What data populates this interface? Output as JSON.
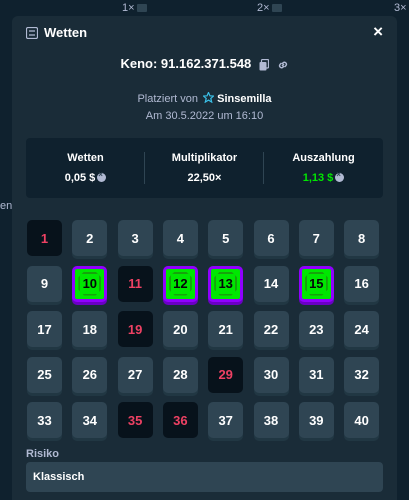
{
  "background": {
    "multipliers": [
      "1×",
      "2×",
      "3×"
    ],
    "side_text": "en"
  },
  "modal": {
    "title": "Wetten",
    "title_icon": "ticket-icon",
    "close_label": "×",
    "game_id": "Keno: 91.162.371.548",
    "placed_by_prefix": "Platziert von",
    "username": "Sinsemilla",
    "date": "Am 30.5.2022 um 16:10"
  },
  "stats": {
    "bet_label": "Wetten",
    "bet_value": "0,05 $",
    "multiplier_label": "Multiplikator",
    "multiplier_value": "22,50×",
    "payout_label": "Auszahlung",
    "payout_value": "1,13 $"
  },
  "keno": {
    "numbers": [
      "1",
      "2",
      "3",
      "4",
      "5",
      "6",
      "7",
      "8",
      "9",
      "10",
      "11",
      "12",
      "13",
      "14",
      "15",
      "16",
      "17",
      "18",
      "19",
      "20",
      "21",
      "22",
      "23",
      "24",
      "25",
      "26",
      "27",
      "28",
      "29",
      "30",
      "31",
      "32",
      "33",
      "34",
      "35",
      "36",
      "37",
      "38",
      "39",
      "40"
    ],
    "drawn_miss": [
      1,
      11,
      19,
      29,
      35,
      36
    ],
    "hits": [
      10,
      12,
      13,
      15
    ]
  },
  "risk": {
    "label": "Risiko",
    "value": "Klassisch"
  },
  "colors": {
    "background": "#0f212e",
    "panel": "#1a2c38",
    "tile": "#2f4553",
    "hit": "#00e701",
    "hit_border": "#9000ff",
    "miss_text": "#ed4163"
  }
}
